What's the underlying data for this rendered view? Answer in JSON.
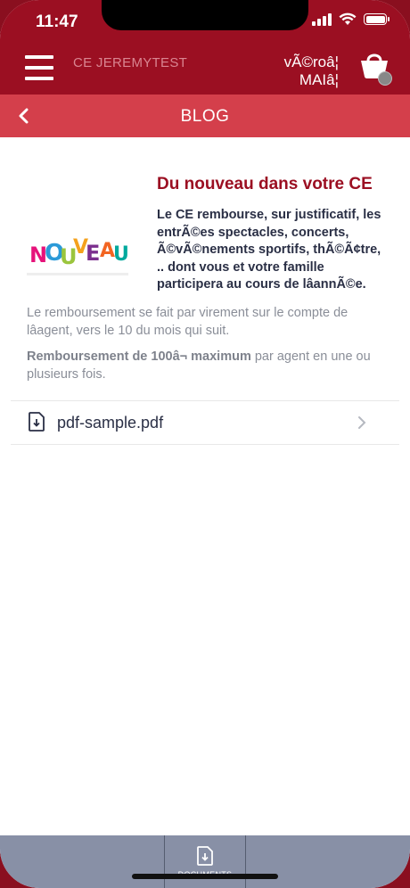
{
  "status": {
    "time": "11:47"
  },
  "header": {
    "org_name": "CE JEREMYTEST",
    "user_line1": "vÃ©roâ¦",
    "user_line2": "MAIâ¦"
  },
  "subheader": {
    "title": "BLOG"
  },
  "article": {
    "image_text": "NOUVEAU",
    "headline": "Du nouveau dans votre CE",
    "lead": "Le CE rembourse, sur justificatif, les entrÃ©es spectacles, concerts, Ã©vÃ©nements sportifs, thÃ©Ã¢tre, .. dont vous et votre famille participera au cours de lâannÃ©e.",
    "para1": "Le remboursement se fait par virement sur le compte de lâagent, vers le 10 du mois qui suit.",
    "para2_bold": "Remboursement de 100â¬ maximum",
    "para2_rest": " par agent en une ou plusieurs fois."
  },
  "document": {
    "file_name": "pdf-sample.pdf",
    "icon": "file-download-icon"
  },
  "tabbar": {
    "documents_label": "DOCUMENTS"
  },
  "colors": {
    "primary": "#9b0f22",
    "secondary": "#d43f4b",
    "text_dark": "#2a2f45",
    "text_muted": "#8a8e98",
    "tabbar": "#8890a6"
  }
}
